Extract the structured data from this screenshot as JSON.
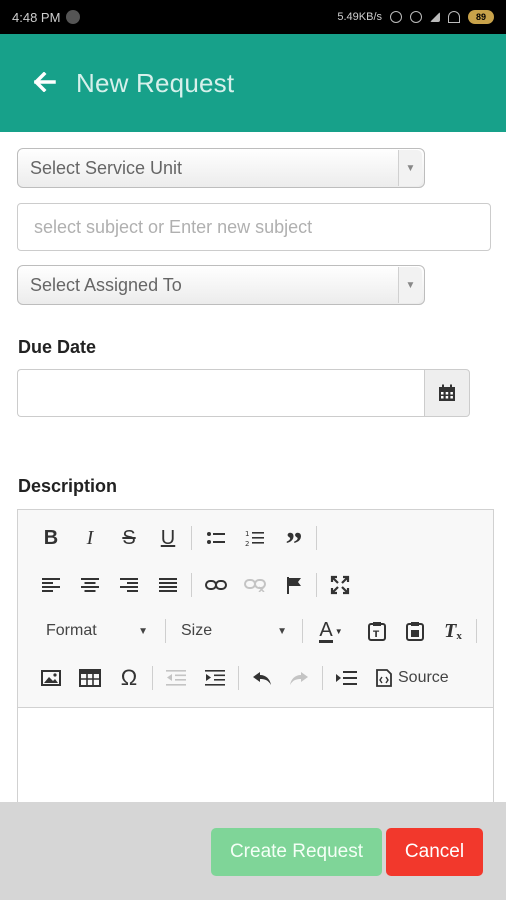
{
  "status_bar": {
    "time": "4:48 PM",
    "network_speed": "5.49KB/s",
    "battery": "89"
  },
  "app_bar": {
    "back_icon": "arrow-left-icon",
    "title": "New Request",
    "color": "#17a18a"
  },
  "form": {
    "service_unit": {
      "placeholder": "Select Service Unit"
    },
    "subject": {
      "placeholder": "select subject or Enter new subject"
    },
    "assigned_to": {
      "placeholder": "Select Assigned To"
    },
    "due_date": {
      "label": "Due Date",
      "value": "",
      "calendar_icon": "calendar-icon"
    },
    "description": {
      "label": "Description",
      "value": ""
    }
  },
  "editor_toolbar": {
    "row1": [
      "bold-icon",
      "italic-icon",
      "strikethrough-icon",
      "underline-icon",
      "bulleted-list-icon",
      "numbered-list-icon",
      "blockquote-icon"
    ],
    "row2": [
      "align-left-icon",
      "align-center-icon",
      "align-right-icon",
      "justify-icon",
      "link-icon",
      "unlink-icon",
      "anchor-flag-icon",
      "maximize-icon"
    ],
    "format_label": "Format",
    "size_label": "Size",
    "row3_icons": [
      "text-color-icon",
      "paste-text-icon",
      "paste-word-icon",
      "remove-format-icon"
    ],
    "row4": [
      "image-icon",
      "table-icon",
      "special-char-icon",
      "outdent-icon",
      "indent-icon",
      "undo-icon",
      "redo-icon",
      "insert-line-icon",
      "source-icon"
    ],
    "source_label": "Source"
  },
  "footer": {
    "create_label": "Create Request",
    "cancel_label": "Cancel",
    "create_color": "#7fd598",
    "cancel_color": "#f2382c"
  }
}
